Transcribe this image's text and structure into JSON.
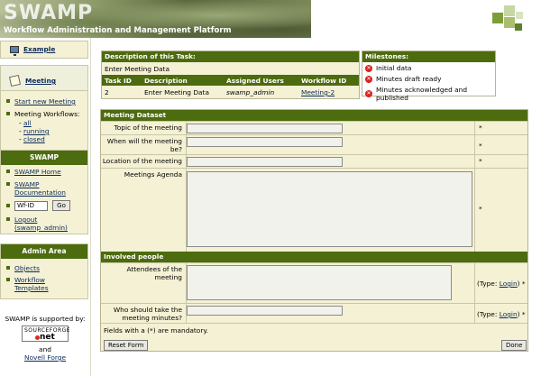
{
  "header": {
    "logo": "SWAMP",
    "subtitle": "Workflow Administration and Management Platform"
  },
  "sidebar": {
    "example": {
      "label": "Example"
    },
    "meeting": {
      "title": "Meeting",
      "start_new": "Start new Meeting",
      "workflows_label": "Meeting Workflows:",
      "filters": [
        "all",
        "running",
        "closed"
      ]
    },
    "swamp": {
      "title": "SWAMP",
      "home": "SWAMP Home",
      "doc_line1": "SWAMP",
      "doc_line2": "Documentation",
      "wfid_value": "Wf-ID",
      "go": "Go",
      "logout_line1": "Logout",
      "logout_line2": "(swamp_admin)"
    },
    "admin": {
      "title": "Admin Area",
      "objects": "Objects",
      "templates_line1": "Workflow",
      "templates_line2": "Templates"
    },
    "supported": {
      "text": "SWAMP is supported by:",
      "sf_line1": "SOURCEFORGE",
      "sf_line2": "net",
      "and": "and",
      "novell": "Novell Forge"
    }
  },
  "task": {
    "title": "Description of this Task:",
    "description": "Enter Meeting Data",
    "columns": [
      "Task ID",
      "Description",
      "Assigned Users",
      "Workflow ID"
    ],
    "row": {
      "id": "2",
      "desc": "Enter Meeting Data",
      "users": "swamp_admin",
      "workflow": "Meeting-2"
    }
  },
  "milestones": {
    "title": "Milestones:",
    "items": [
      "Initial data",
      "Minutes draft ready",
      "Minutes acknowledged and published"
    ]
  },
  "dataset": {
    "title": "Meeting Dataset",
    "fields": {
      "topic": "Topic of the meeting",
      "when1": "When will the meeting",
      "when2": "be?",
      "location": "Location of the meeting",
      "agenda": "Meetings Agenda"
    },
    "star": "*",
    "people_title": "Involved people",
    "attendees1": "Attendees of the",
    "attendees2": "meeting",
    "minutes1": "Who should take the",
    "minutes2": "meeting minutes?",
    "type_prefix": "(Type: ",
    "type_link": "Login",
    "type_suffix": ") *",
    "mandatory_note": "Fields with a (*) are mandatory.",
    "reset": "Reset Form",
    "done": "Done"
  }
}
